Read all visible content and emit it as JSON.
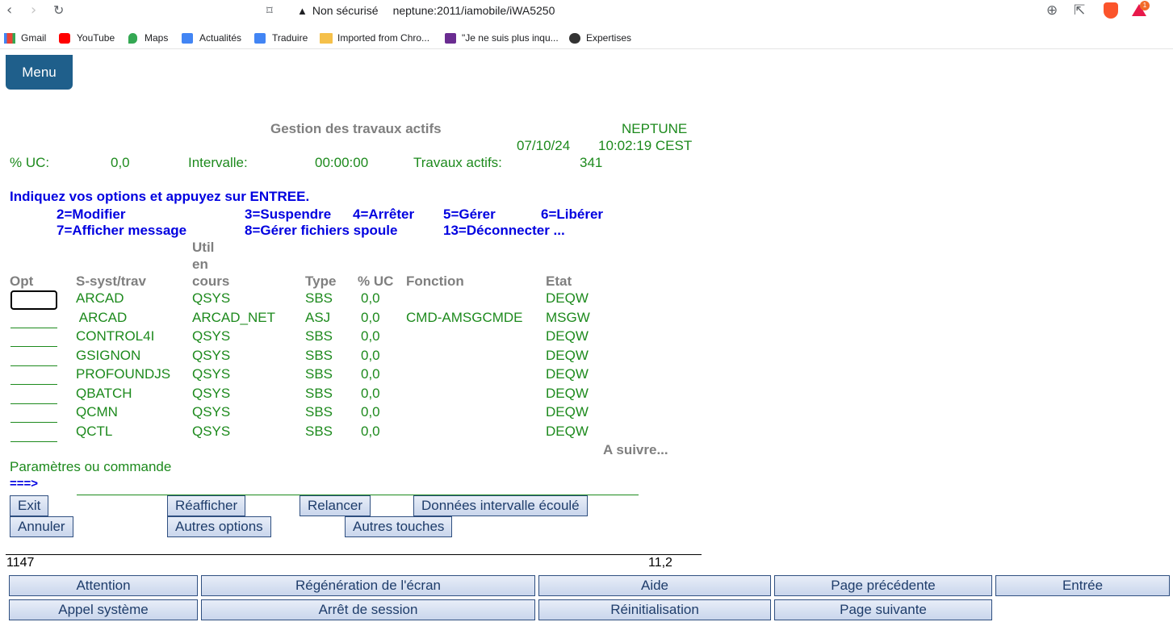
{
  "browser": {
    "security_label": "Non sécurisé",
    "url": "neptune:2011/iamobile/iWA5250",
    "brave_badge": "1",
    "bookmarks": [
      {
        "label": "Gmail",
        "icon": "gmail-icon"
      },
      {
        "label": "YouTube",
        "icon": "youtube-icon"
      },
      {
        "label": "Maps",
        "icon": "maps-icon"
      },
      {
        "label": "Actualités",
        "icon": "news-icon"
      },
      {
        "label": "Traduire",
        "icon": "translate-icon"
      },
      {
        "label": "Imported from Chro...",
        "icon": "folder-icon"
      },
      {
        "label": "\"Je ne suis plus inqu...",
        "icon": "bookmark-page-icon"
      },
      {
        "label": "Expertises",
        "icon": "globe-icon"
      }
    ]
  },
  "app": {
    "menu_label": "Menu",
    "screen_title": "Gestion des travaux actifs",
    "system_name": "NEPTUNE",
    "date": "07/10/24",
    "time": "10:02:19 CEST",
    "cpu_label": "% UC:",
    "cpu_value": "0,0",
    "interval_label": "Intervalle:",
    "interval_value": "00:00:00",
    "active_jobs_label": "Travaux actifs:",
    "active_jobs_value": "341",
    "instructions": "Indiquez vos options et appuyez sur ENTREE.",
    "options": {
      "o2": "2=Modifier",
      "o3": "3=Suspendre",
      "o4": "4=Arrêter",
      "o5": "5=Gérer",
      "o6": "6=Libérer",
      "o7": "7=Afficher message",
      "o8": "8=Gérer fichiers spoule",
      "o13": "13=Déconnecter ..."
    },
    "columns": {
      "opt": "Opt",
      "subsys": "S-syst/trav",
      "user_l1": "Util",
      "user_l2": "en",
      "user_l3": "cours",
      "type": "Type",
      "cpu": "% UC",
      "function": "Fonction",
      "status": "Etat"
    },
    "rows": [
      {
        "name": "ARCAD",
        "user": "QSYS",
        "type": "SBS",
        "cpu": "0,0",
        "function": "",
        "status": "DEQW"
      },
      {
        "name": " ARCAD",
        "user": "ARCAD_NET",
        "type": "ASJ",
        "cpu": "0,0",
        "function": "CMD-AMSGCMDE",
        "status": "MSGW"
      },
      {
        "name": "CONTROL4I",
        "user": "QSYS",
        "type": "SBS",
        "cpu": "0,0",
        "function": "",
        "status": "DEQW"
      },
      {
        "name": "GSIGNON",
        "user": "QSYS",
        "type": "SBS",
        "cpu": "0,0",
        "function": "",
        "status": "DEQW"
      },
      {
        "name": "PROFOUNDJS",
        "user": "QSYS",
        "type": "SBS",
        "cpu": "0,0",
        "function": "",
        "status": "DEQW"
      },
      {
        "name": "QBATCH",
        "user": "QSYS",
        "type": "SBS",
        "cpu": "0,0",
        "function": "",
        "status": "DEQW"
      },
      {
        "name": "QCMN",
        "user": "QSYS",
        "type": "SBS",
        "cpu": "0,0",
        "function": "",
        "status": "DEQW"
      },
      {
        "name": "QCTL",
        "user": "QSYS",
        "type": "SBS",
        "cpu": "0,0",
        "function": "",
        "status": "DEQW"
      }
    ],
    "more": "A suivre...",
    "params_label": "Paramètres ou commande",
    "prompt": "===>",
    "fkeys": {
      "exit": "Exit",
      "refresh": "Réafficher",
      "restart": "Relancer",
      "interval_data": "Données intervalle écoulé",
      "cancel": "Annuler",
      "more_options": "Autres options",
      "more_keys": "Autres touches"
    },
    "status_left": "1147",
    "status_cursor": "11,2",
    "bottom_buttons": {
      "attention": "Attention",
      "refresh_screen": "Régénération de l'écran",
      "help": "Aide",
      "page_up": "Page précédente",
      "enter": "Entrée",
      "sys_request": "Appel système",
      "end_session": "Arrêt de session",
      "reset": "Réinitialisation",
      "page_down": "Page suivante"
    }
  }
}
